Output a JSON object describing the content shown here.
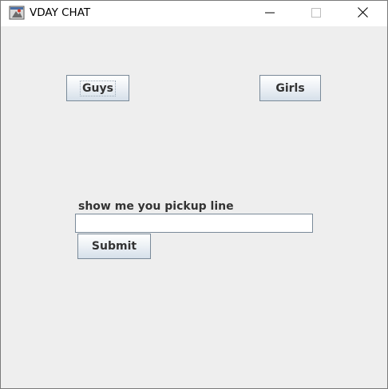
{
  "window": {
    "title": "VDAY CHAT",
    "icon": "java-app-icon",
    "controls": {
      "minimize_icon": "minimize-icon",
      "maximize_icon": "maximize-icon",
      "close_icon": "close-icon"
    }
  },
  "buttons": {
    "guys_label": "Guys",
    "girls_label": "Girls",
    "submit_label": "Submit"
  },
  "form": {
    "label": "show me you pickup line",
    "input_value": ""
  },
  "colors": {
    "background": "#eeeeee",
    "titlebar": "#ffffff",
    "button_text": "#333333",
    "button_border": "#7a8a99"
  }
}
